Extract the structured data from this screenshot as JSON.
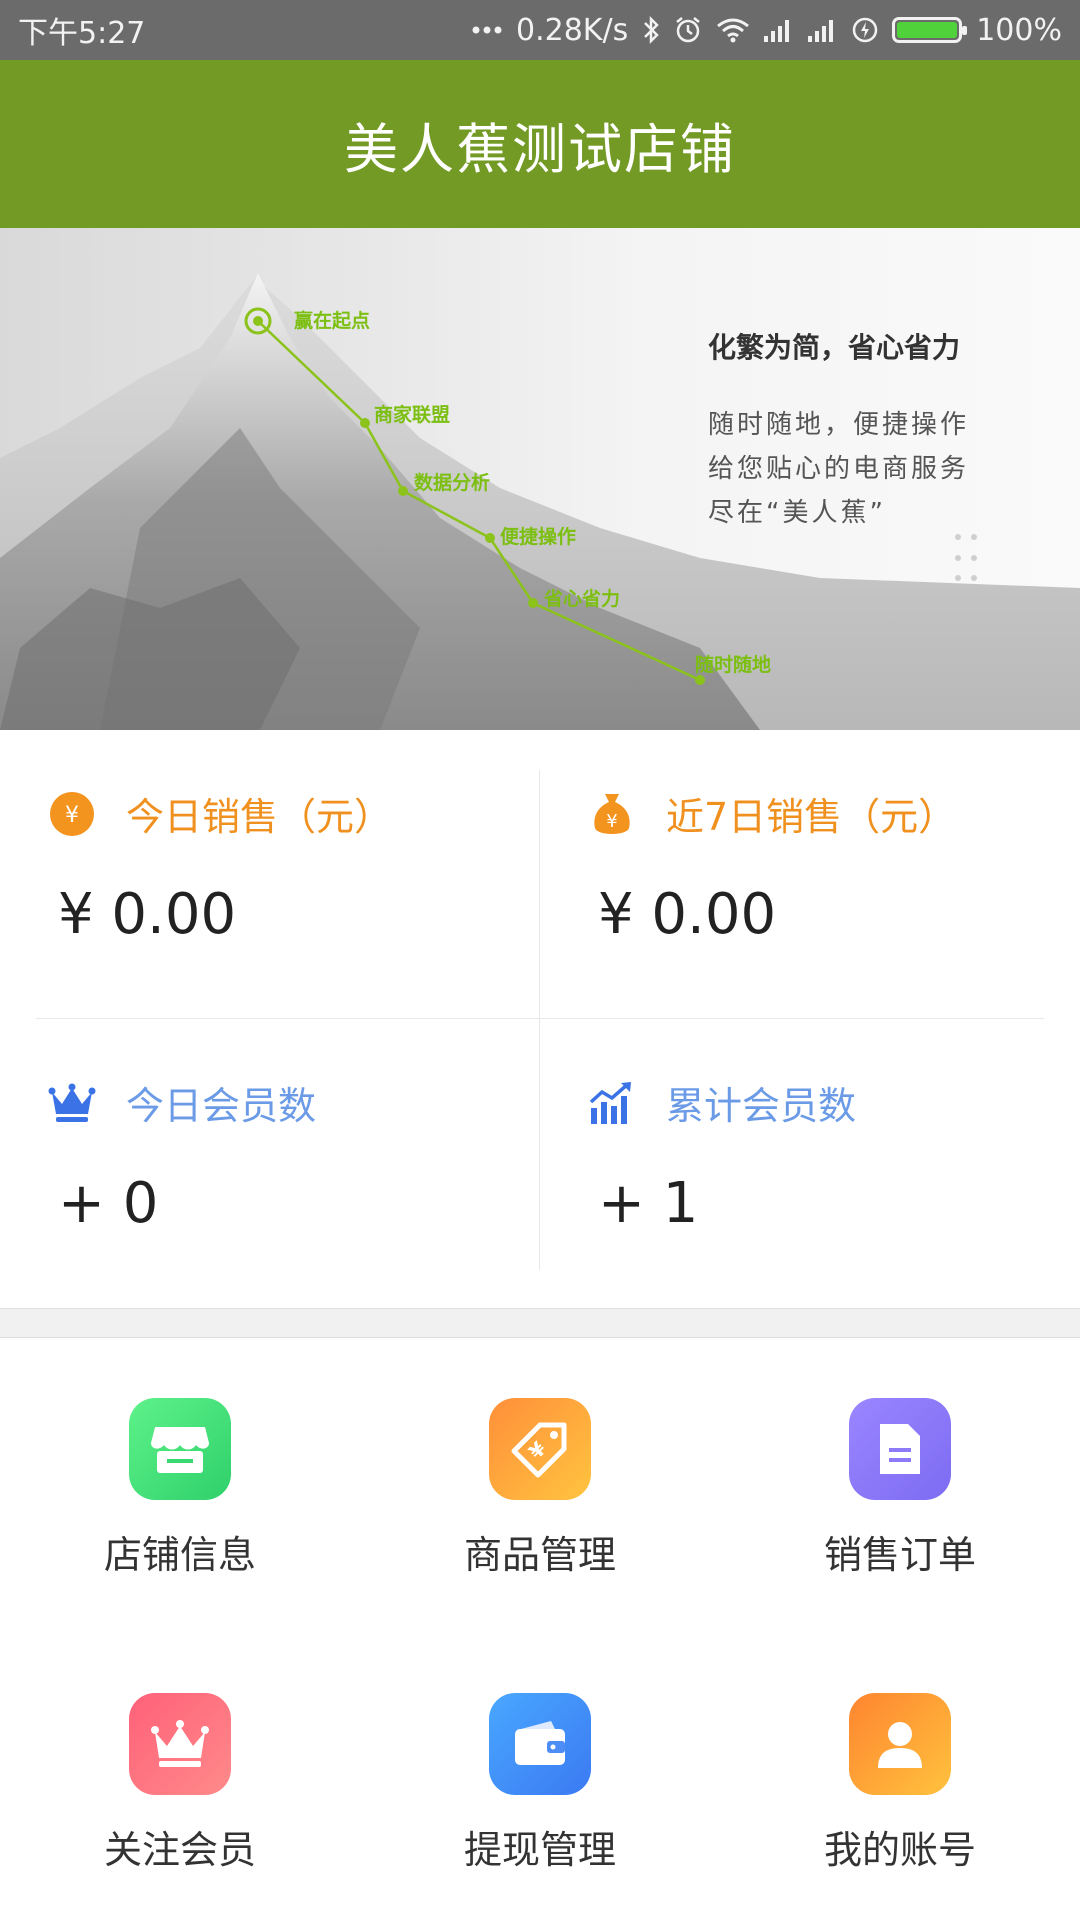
{
  "status_bar": {
    "time": "下午5:27",
    "network_speed": "0.28K/s",
    "battery_percent": "100%",
    "icons": [
      "dots-icon",
      "bluetooth-icon",
      "alarm-icon",
      "wifi-icon",
      "signal-icon",
      "signal-icon",
      "charging-icon",
      "battery-icon"
    ]
  },
  "header": {
    "title": "美人蕉测试店铺"
  },
  "banner": {
    "route_labels": [
      "赢在起点",
      "商家联盟",
      "数据分析",
      "便捷操作",
      "省心省力",
      "随时随地"
    ],
    "slogan": "化繁为简，省心省力",
    "lines": [
      "随时随地，便捷操作",
      "给您贴心的电商服务",
      "尽在“美人蕉”"
    ],
    "accent_color": "#7cbf12"
  },
  "stats": [
    {
      "label": "今日销售（元）",
      "value": "¥ 0.00",
      "icon": "yen-coin-icon",
      "color": "#f0901e"
    },
    {
      "label": "近7日销售（元）",
      "value": "¥ 0.00",
      "icon": "money-bag-icon",
      "color": "#f0901e"
    },
    {
      "label": "今日会员数",
      "value": "+ 0",
      "icon": "crown-icon",
      "color": "#6b9be6"
    },
    {
      "label": "累计会员数",
      "value": "+ 1",
      "icon": "growth-chart-icon",
      "color": "#6b9be6"
    }
  ],
  "menu": [
    {
      "label": "店铺信息",
      "icon": "store-icon"
    },
    {
      "label": "商品管理",
      "icon": "price-tag-icon"
    },
    {
      "label": "销售订单",
      "icon": "document-icon"
    },
    {
      "label": "关注会员",
      "icon": "crown-icon"
    },
    {
      "label": "提现管理",
      "icon": "wallet-icon"
    },
    {
      "label": "我的账号",
      "icon": "user-icon"
    }
  ],
  "colors": {
    "header_bg": "#729a25",
    "status_bar_bg": "#6b6b6b"
  }
}
